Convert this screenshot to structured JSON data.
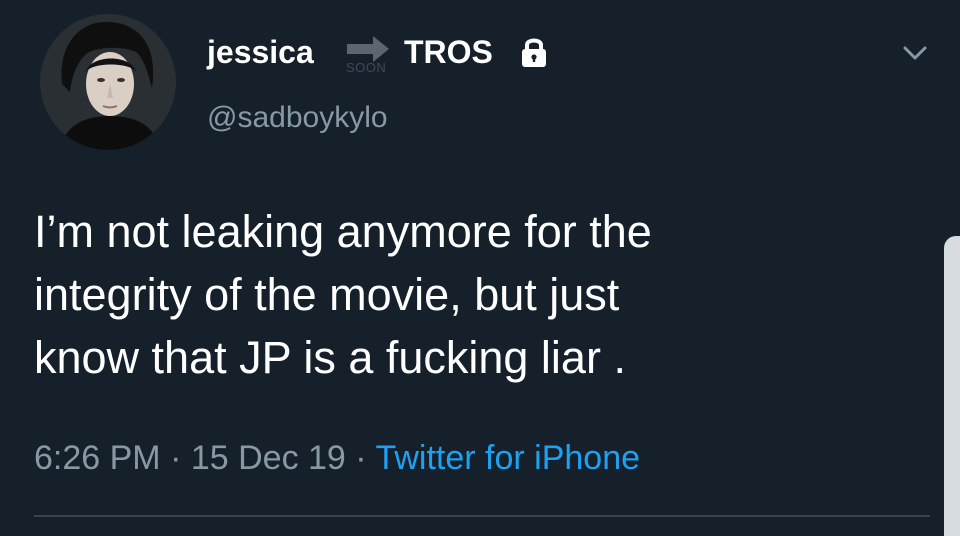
{
  "tweet": {
    "display_name": "jessica",
    "name_suffix": "TROS",
    "arrow_caption": "SOON",
    "handle": "@sadboykylo",
    "text": "I’m not leaking anymore for the\nintegrity of the movie, but just\nknow that JP is a fucking liar .",
    "time": "6:26 PM",
    "separator": " · ",
    "date": "15 Dec 19",
    "source": "Twitter for iPhone"
  },
  "icons": {
    "arrow": "right-arrow-icon",
    "lock": "lock-icon",
    "menu": "chevron-down-icon",
    "avatar": "avatar"
  },
  "colors": {
    "background": "#15202b",
    "primary_text": "#ffffff",
    "secondary_text": "#8899a6",
    "link": "#1da1f2",
    "divider": "#38444d"
  }
}
